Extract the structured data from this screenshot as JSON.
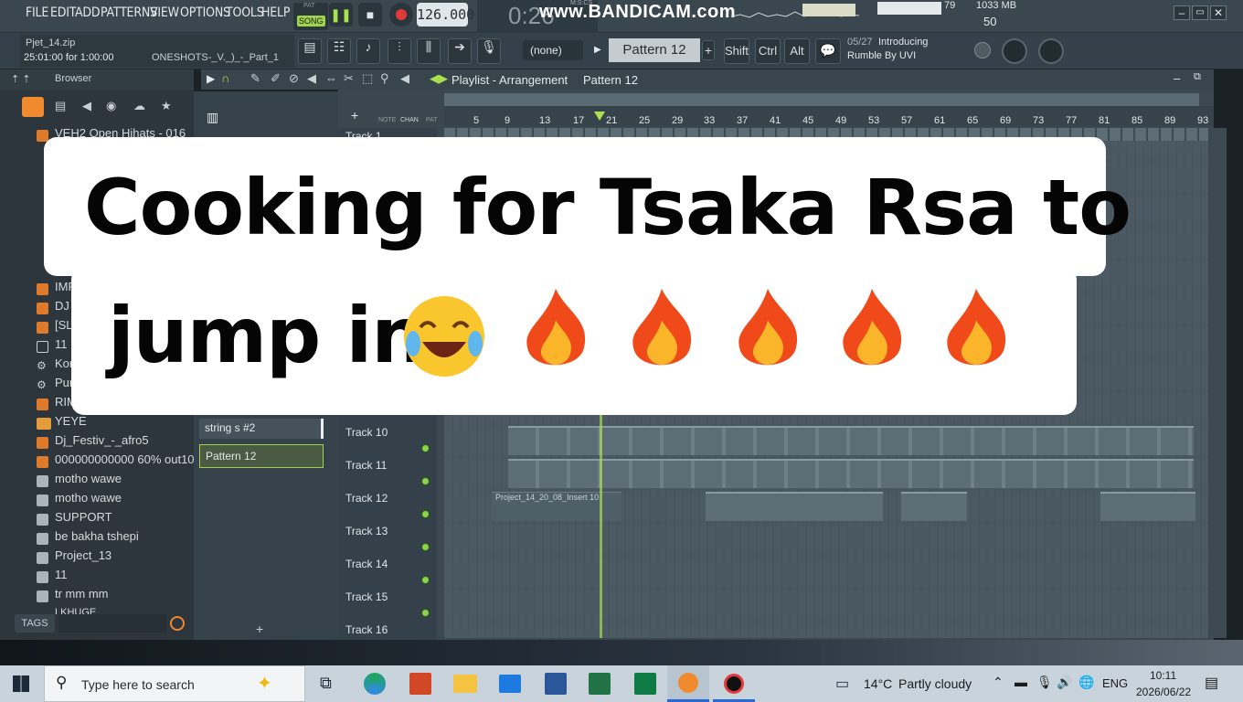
{
  "menu": [
    "FILE",
    "EDIT",
    "ADD",
    "PATTERNS",
    "VIEW",
    "OPTIONS",
    "TOOLS",
    "HELP"
  ],
  "transport": {
    "pat_label": "PAT",
    "song_label": "SONG",
    "tempo": "126.000",
    "time": "0:26",
    "mscs": "M:S:CS"
  },
  "watermark": "www.BANDICAM.com",
  "cpu": {
    "value": "79",
    "memory": "1033 MB",
    "polyphony": "50"
  },
  "project": {
    "file": "Pjet_14.zip",
    "time": "25:01:00 for 1:00:00",
    "sample": "ONESHOTS-_V._)_-_Part_1"
  },
  "toolbar": {
    "none": "(none)",
    "pattern": "Pattern 12",
    "plus": "+",
    "shift": "Shift",
    "ctrl": "Ctrl",
    "alt": "Alt",
    "news_date": "05/27",
    "news_title": "Introducing",
    "news_sub": "Rumble By UVI"
  },
  "browser": {
    "title": "Browser",
    "tags": "TAGS",
    "items": [
      "VEH2 Open Hihats - 016",
      "IMP",
      "DJ",
      "[SL",
      "11",
      "Kon",
      "Pur",
      "RIM",
      "YEYE",
      "Dj_Festiv_-_afro5",
      "000000000000 60% out10%",
      "motho wawe",
      "motho wawe",
      "SUPPORT",
      "be bakha tshepi",
      "Project_13",
      "11",
      "tr mm mm",
      "LKHUGE"
    ]
  },
  "channels": {
    "string": "string s #2",
    "pattern": "Pattern 12",
    "plus": "+"
  },
  "playlist": {
    "title": "Playlist - Arrangement",
    "pattern": "Pattern 12",
    "note": "NOTE",
    "chan": "CHAN",
    "pat": "PAT",
    "ruler": [
      "5",
      "9",
      "13",
      "17",
      "21",
      "25",
      "29",
      "33",
      "37",
      "41",
      "45",
      "49",
      "53",
      "57",
      "61",
      "65",
      "69",
      "73",
      "77",
      "81",
      "85",
      "89",
      "93"
    ],
    "tracks": [
      "Track 1",
      "Track 10",
      "Track 11",
      "Track 12",
      "Track 13",
      "Track 14",
      "Track 15",
      "Track 16"
    ],
    "clip_audio": "Project_14_20_08_Insert 10"
  },
  "caption": {
    "line1": "Cooking for Tsaka Rsa to",
    "line2": "jump in"
  },
  "taskbar": {
    "search": "Type here to search",
    "weather": "14°C",
    "weather_desc": "Partly cloudy",
    "lang": "ENG",
    "time": "10:11",
    "date": "2026/06/22"
  }
}
